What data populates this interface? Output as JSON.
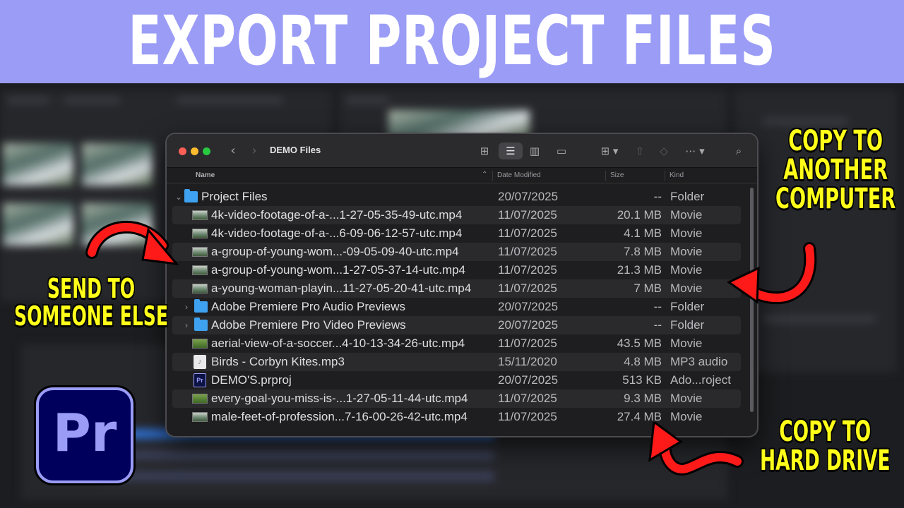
{
  "banner": {
    "title": "EXPORT PROJECT FILES"
  },
  "finder": {
    "window_title": "DEMO Files",
    "toolbar_icons": [
      "back-icon",
      "forward-icon",
      "icon-view-icon",
      "list-view-icon",
      "column-view-icon",
      "gallery-view-icon",
      "group-icon",
      "share-icon",
      "tag-icon",
      "more-icon",
      "search-icon"
    ],
    "columns": {
      "name": "Name",
      "date": "Date Modified",
      "size": "Size",
      "kind": "Kind"
    },
    "rows": [
      {
        "name": "Project Files",
        "date": "20/07/2025",
        "size": "--",
        "kind": "Folder",
        "icon": "folder-icon",
        "expanded": true
      },
      {
        "name": "4k-video-footage-of-a-...1-27-05-35-49-utc.mp4",
        "date": "11/07/2025",
        "size": "20.1 MB",
        "kind": "Movie",
        "icon": "movie-icon"
      },
      {
        "name": "4k-video-footage-of-a-...6-09-06-12-57-utc.mp4",
        "date": "11/07/2025",
        "size": "4.1 MB",
        "kind": "Movie",
        "icon": "movie-icon"
      },
      {
        "name": "a-group-of-young-wom...-09-05-09-40-utc.mp4",
        "date": "11/07/2025",
        "size": "7.8 MB",
        "kind": "Movie",
        "icon": "movie-icon"
      },
      {
        "name": "a-group-of-young-wom...1-27-05-37-14-utc.mp4",
        "date": "11/07/2025",
        "size": "21.3 MB",
        "kind": "Movie",
        "icon": "movie-icon"
      },
      {
        "name": "a-young-woman-playin...11-27-05-20-41-utc.mp4",
        "date": "11/07/2025",
        "size": "7 MB",
        "kind": "Movie",
        "icon": "movie-icon"
      },
      {
        "name": "Adobe Premiere Pro Audio Previews",
        "date": "20/07/2025",
        "size": "--",
        "kind": "Folder",
        "icon": "folder-icon",
        "collapsed": true
      },
      {
        "name": "Adobe Premiere Pro Video Previews",
        "date": "20/07/2025",
        "size": "--",
        "kind": "Folder",
        "icon": "folder-icon",
        "collapsed": true
      },
      {
        "name": "aerial-view-of-a-soccer...4-10-13-34-26-utc.mp4",
        "date": "11/07/2025",
        "size": "43.5 MB",
        "kind": "Movie",
        "icon": "movie-icon"
      },
      {
        "name": "Birds - Corbyn Kites.mp3",
        "date": "15/11/2020",
        "size": "4.8 MB",
        "kind": "MP3 audio",
        "icon": "audio-file-icon"
      },
      {
        "name": "DEMO'S.prproj",
        "date": "20/07/2025",
        "size": "513 KB",
        "kind": "Ado...roject",
        "icon": "premiere-project-icon"
      },
      {
        "name": "every-goal-you-miss-is-...1-27-05-11-44-utc.mp4",
        "date": "11/07/2025",
        "size": "9.3 MB",
        "kind": "Movie",
        "icon": "movie-icon"
      },
      {
        "name": "male-feet-of-profession...7-16-00-26-42-utc.mp4",
        "date": "11/07/2025",
        "size": "27.4 MB",
        "kind": "Movie",
        "icon": "movie-icon"
      }
    ]
  },
  "callouts": {
    "right_top": [
      "COPY TO",
      "ANOTHER",
      "COMPUTER"
    ],
    "left": [
      "SEND TO",
      "SOMEONE ELSE"
    ],
    "right_bottom": [
      "COPY TO",
      "HARD DRIVE"
    ]
  },
  "logo": {
    "text": "Pr"
  },
  "colors": {
    "banner": "#9a9cf6",
    "callout_text": "#ffff1a",
    "arrow": "#ff1a1a",
    "folder": "#3ea2f1"
  }
}
